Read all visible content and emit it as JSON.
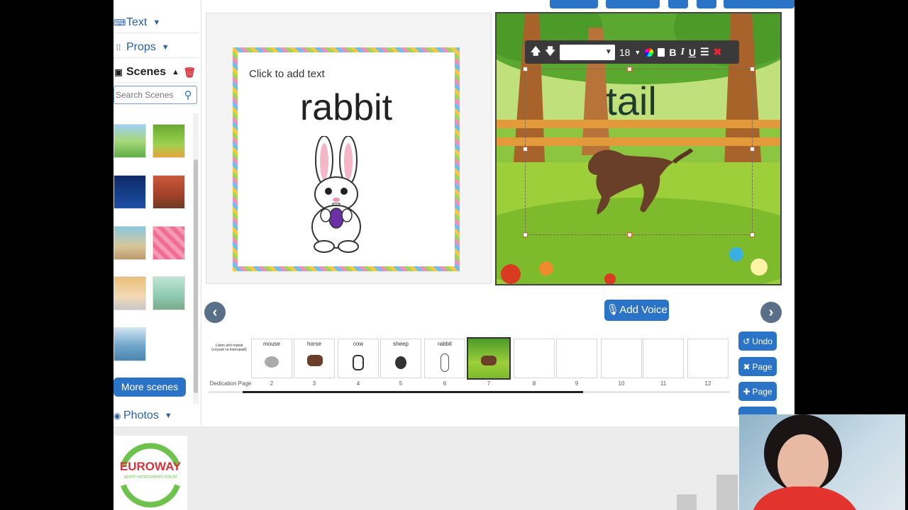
{
  "sidebar": {
    "text_label": "Text",
    "props_label": "Props",
    "scenes_label": "Scenes",
    "search_placeholder": "Search Scenes",
    "more_scenes_label": "More scenes",
    "photos_label": "Photos"
  },
  "left_page": {
    "placeholder": "Click to add text",
    "word": "rabbit"
  },
  "right_page": {
    "word": "tail",
    "toolbar": {
      "font_size": "18",
      "bold": "B",
      "italic": "I",
      "underline": "U"
    }
  },
  "add_voice_label": "Add Voice",
  "filmstrip": [
    {
      "num": "Dedication Page",
      "label": "Listen and repeat (слухай та повторюй)"
    },
    {
      "num": "2",
      "label": "mouse"
    },
    {
      "num": "3",
      "label": "horse"
    },
    {
      "num": "4",
      "label": "cow"
    },
    {
      "num": "5",
      "label": "sheep"
    },
    {
      "num": "6",
      "label": "rabbit"
    },
    {
      "num": "7",
      "label": ""
    },
    {
      "num": "8",
      "label": ""
    },
    {
      "num": "9",
      "label": ""
    },
    {
      "num": "10",
      "label": ""
    },
    {
      "num": "11",
      "label": ""
    },
    {
      "num": "12",
      "label": ""
    }
  ],
  "buttons": {
    "undo": "Undo",
    "delete_page": "Page",
    "add_page": "Page"
  },
  "logo": {
    "name": "EUROWAY",
    "subtitle": "ЦЕНТР НЕПЕРЕРВНОЇ ОСВІТИ"
  },
  "colors": {
    "accent": "#2b73c7",
    "logo_green": "#6cc24a",
    "logo_red": "#d9323a"
  }
}
